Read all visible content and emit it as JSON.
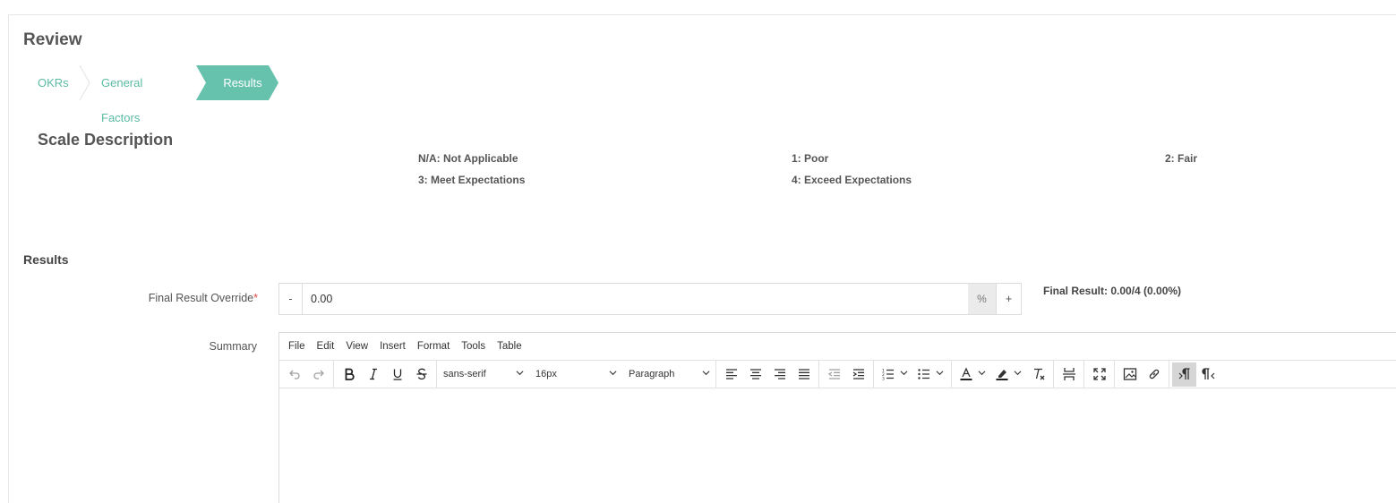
{
  "page": {
    "title": "Review"
  },
  "steps": [
    {
      "label": "OKRs",
      "active": false
    },
    {
      "label": "General Factors",
      "active": false
    },
    {
      "label": "Results",
      "active": true
    }
  ],
  "scale": {
    "title": "Scale Description",
    "items": [
      "N/A: Not Applicable",
      "1: Poor",
      "2: Fair",
      "3: Meet Expectations",
      "4: Exceed Expectations"
    ]
  },
  "results": {
    "section_title": "Results",
    "override": {
      "label": "Final Result Override",
      "required_mark": "*",
      "minus": "-",
      "value": "0.00",
      "unit": "%",
      "plus": "+"
    },
    "final_result": "Final Result: 0.00/4 (0.00%)",
    "summary": {
      "label": "Summary",
      "menu": [
        "File",
        "Edit",
        "View",
        "Insert",
        "Format",
        "Tools",
        "Table"
      ],
      "font_family": "sans-serif",
      "font_size": "16px",
      "block_format": "Paragraph"
    }
  },
  "colors": {
    "accent": "#66c2ac",
    "required": "#e04848"
  }
}
